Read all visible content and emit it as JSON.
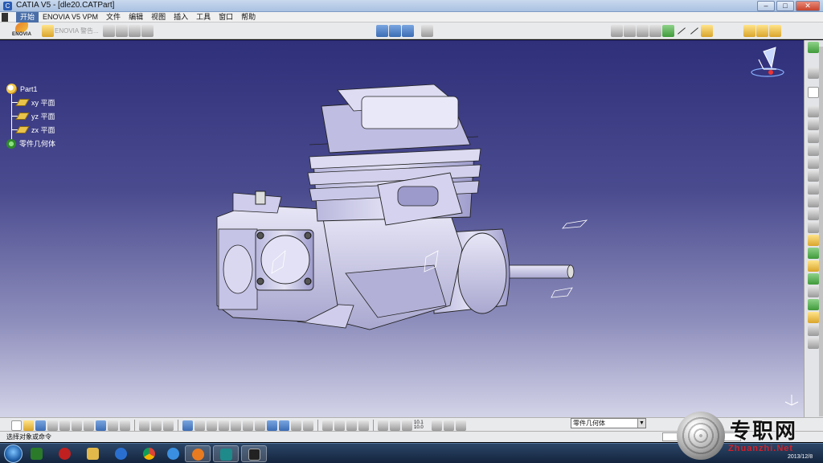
{
  "window": {
    "title": "CATIA V5 - [dle20.CATPart]",
    "controls": {
      "minimize": "–",
      "maximize": "□",
      "close": "✕"
    }
  },
  "menu": {
    "items": [
      "开始",
      "ENOVIA V5 VPM",
      "文件",
      "编辑",
      "视图",
      "插入",
      "工具",
      "窗口",
      "帮助"
    ]
  },
  "toolbar_top": {
    "logo_text": "ENOVIA",
    "enovia_label": "ENOVIA 警告..."
  },
  "tree": {
    "root": "Part1",
    "children": [
      {
        "label": "xy 平面",
        "icon": "plane-icon"
      },
      {
        "label": "yz 平面",
        "icon": "plane-icon"
      },
      {
        "label": "zx 平面",
        "icon": "plane-icon"
      },
      {
        "label": "零件几何体",
        "icon": "part-body-icon"
      }
    ]
  },
  "bottom_toolbar": {
    "body_select_value": "零件几何体",
    "num_display": "10.1 10.0"
  },
  "status": {
    "text": "选择对象或命令"
  },
  "taskbar": {
    "date": "2013/12/8"
  },
  "watermark": {
    "cn": "专职网",
    "en": "Zhuanzhi.Net"
  },
  "colors": {
    "viewport_top": "#2f2f7a",
    "viewport_bottom": "#d3d3e8",
    "model": "#c8c6e6",
    "accent": "#4a6fa8"
  }
}
